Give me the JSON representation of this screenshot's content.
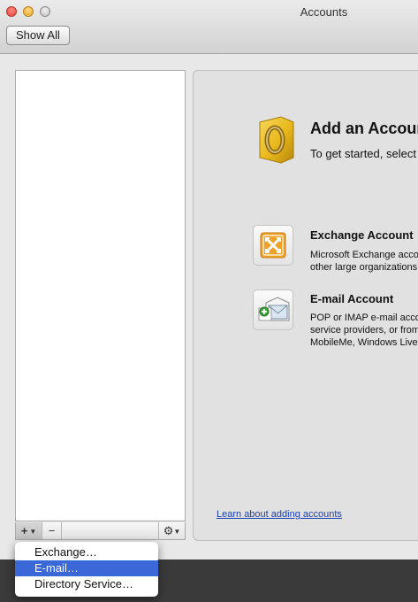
{
  "window": {
    "title": "Accounts",
    "show_all_label": "Show All"
  },
  "list_toolbar": {
    "add_label": "+",
    "remove_label": "−",
    "gear_label": "⚙"
  },
  "main": {
    "heading": "Add an Account",
    "subheading": "To get started, select an account type.",
    "accounts": [
      {
        "title": "Exchange Account",
        "desc_lines": [
          "Microsoft Exchange accounts are used by",
          "other large organizations."
        ],
        "icon": "exchange-icon"
      },
      {
        "title": "E-mail Account",
        "desc_lines": [
          "POP or IMAP e-mail accounts from Internet",
          "service providers, or from e-mail services such as",
          "MobileMe, Windows Live Hotmail, Gmail, or Yahoo!"
        ],
        "icon": "email-icon"
      }
    ],
    "learn_link": "Learn about adding accounts"
  },
  "add_menu": {
    "items": [
      {
        "label": "Exchange…",
        "selected": false
      },
      {
        "label": "E-mail…",
        "selected": true
      },
      {
        "label": "Directory Service…",
        "selected": false
      }
    ]
  },
  "colors": {
    "menu_selection": "#3a68d8",
    "link": "#1a3fb5",
    "outlook_gold": "#e8b71c"
  }
}
